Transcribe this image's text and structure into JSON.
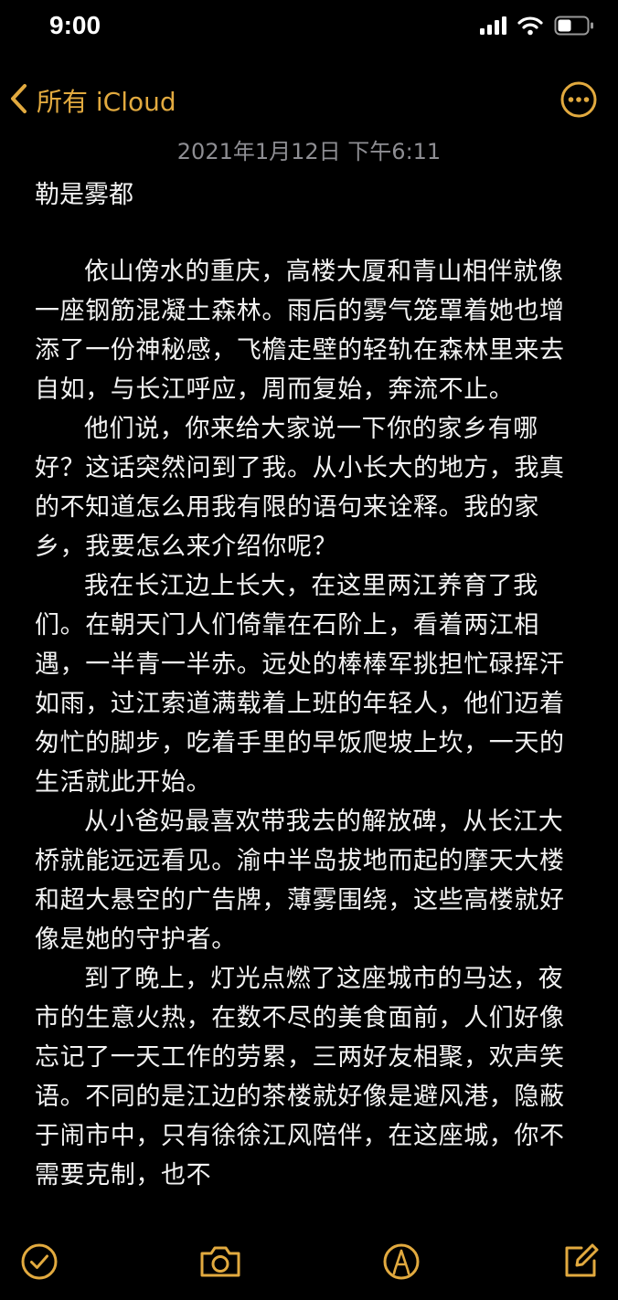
{
  "status_bar": {
    "time": "9:00",
    "icons": [
      "cellular-signal-icon",
      "wifi-icon",
      "battery-icon"
    ]
  },
  "nav": {
    "back_label": "所有 iCloud",
    "back_icon": "chevron-left-icon",
    "more_icon": "ellipsis-circle-icon"
  },
  "note": {
    "date": "2021年1月12日 下午6:11",
    "title": "勒是雾都",
    "paragraphs": [
      "依山傍水的重庆，高楼大厦和青山相伴就像一座钢筋混凝土森林。雨后的雾气笼罩着她也增添了一份神秘感，飞檐走壁的轻轨在森林里来去自如，与长江呼应，周而复始，奔流不止。",
      "他们说，你来给大家说一下你的家乡有哪好？这话突然问到了我。从小长大的地方，我真的不知道怎么用我有限的语句来诠释。我的家乡，我要怎么来介绍你呢？",
      "我在长江边上长大，在这里两江养育了我们。在朝天门人们倚靠在石阶上，看着两江相遇，一半青一半赤。远处的棒棒军挑担忙碌挥汗如雨，过江索道满载着上班的年轻人，他们迈着匆忙的脚步，吃着手里的早饭爬坡上坎，一天的生活就此开始。",
      "从小爸妈最喜欢带我去的解放碑，从长江大桥就能远远看见。渝中半岛拔地而起的摩天大楼和超大悬空的广告牌，薄雾围绕，这些高楼就好像是她的守护者。",
      "到了晚上，灯光点燃了这座城市的马达，夜市的生意火热，在数不尽的美食面前，人们好像忘记了一天工作的劳累，三两好友相聚，欢声笑语。不同的是江边的茶楼就好像是避风港，隐蔽于闹市中，只有徐徐江风陪伴，在这座城，你不需要克制，也不"
    ]
  },
  "toolbar": {
    "items": [
      {
        "icon": "checklist-icon"
      },
      {
        "icon": "camera-icon"
      },
      {
        "icon": "markup-pen-icon"
      },
      {
        "icon": "compose-icon"
      }
    ]
  },
  "colors": {
    "accent": "#e2aa3f",
    "background": "#000000",
    "text": "#f2f2f2",
    "secondary_text": "#8e8e93"
  }
}
